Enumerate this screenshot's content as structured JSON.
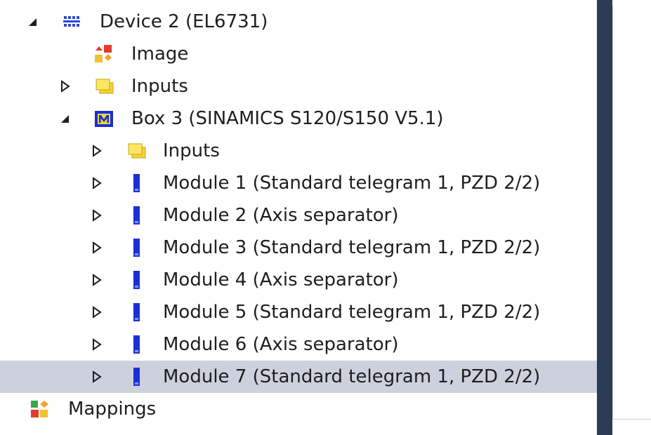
{
  "tree": {
    "device": {
      "label": "Device 2 (EL6731)",
      "icon": "network-device-icon",
      "expanded": true
    },
    "image": {
      "label": "Image",
      "icon": "image-icon"
    },
    "inputs": {
      "label": "Inputs",
      "icon": "inputs-folder-icon",
      "expanded": false
    },
    "box": {
      "label": "Box 3 (SINAMICS S120/S150 V5.1)",
      "icon": "box-icon",
      "expanded": true
    },
    "box_inputs": {
      "label": "Inputs",
      "icon": "inputs-folder-icon",
      "expanded": false
    },
    "modules": [
      {
        "label": "Module 1 (Standard telegram 1, PZD 2/2)",
        "icon": "module-icon",
        "selected": false
      },
      {
        "label": "Module 2 (Axis separator)",
        "icon": "module-icon",
        "selected": false
      },
      {
        "label": "Module 3 (Standard telegram 1, PZD 2/2)",
        "icon": "module-icon",
        "selected": false
      },
      {
        "label": "Module 4 (Axis separator)",
        "icon": "module-icon",
        "selected": false
      },
      {
        "label": "Module 5 (Standard telegram 1, PZD 2/2)",
        "icon": "module-icon",
        "selected": false
      },
      {
        "label": "Module 6 (Axis separator)",
        "icon": "module-icon",
        "selected": false
      },
      {
        "label": "Module 7 (Standard telegram 1, PZD 2/2)",
        "icon": "module-icon",
        "selected": true
      }
    ],
    "mappings": {
      "label": "Mappings",
      "icon": "mappings-icon"
    }
  },
  "colors": {
    "selection": "#cdd1dd",
    "divider": "#2b3a55",
    "module_icon": "#1a2fd6",
    "folder_icon": "#f2d43a"
  }
}
